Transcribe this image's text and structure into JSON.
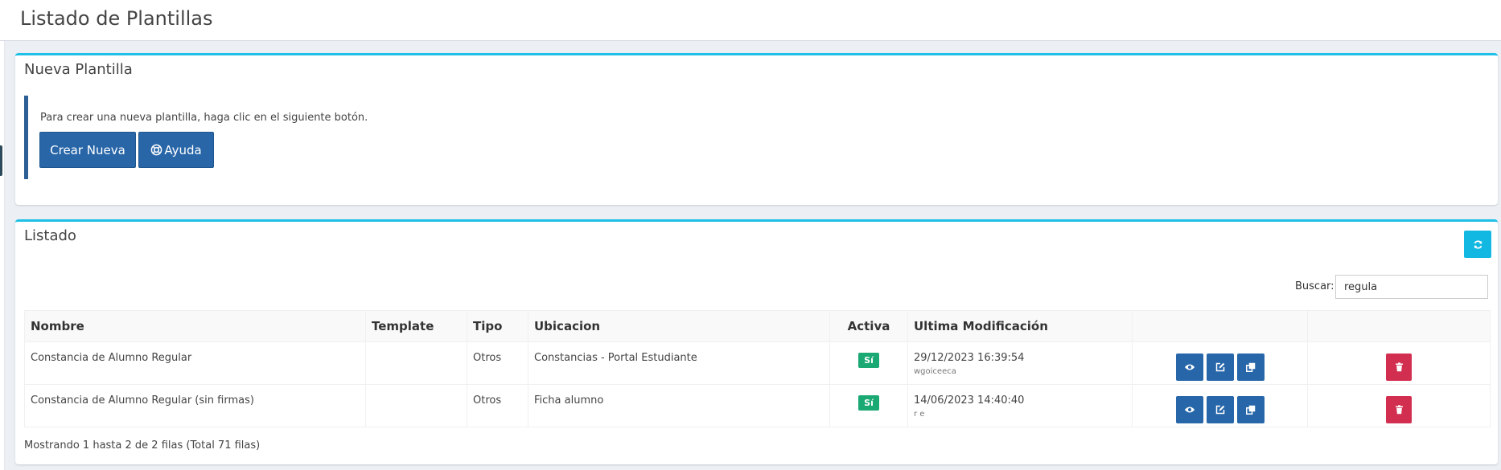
{
  "page": {
    "title": "Listado de Plantillas"
  },
  "new_template": {
    "title": "Nueva Plantilla",
    "description": "Para crear una nueva plantilla, haga clic en el siguiente botón.",
    "create_label": "Crear Nueva",
    "help_label": "Ayuda"
  },
  "listing": {
    "title": "Listado",
    "search_label": "Buscar:",
    "search_value": "regula",
    "columns": [
      "Nombre",
      "Template",
      "Tipo",
      "Ubicacion",
      "Activa",
      "Ultima Modificación"
    ],
    "rows": [
      {
        "nombre": "Constancia de Alumno Regular",
        "template": "",
        "tipo": "Otros",
        "ubicacion": "Constancias - Portal Estudiante",
        "activa": "Sí",
        "modificacion": "29/12/2023 16:39:54",
        "usuario": "wgoiceeca"
      },
      {
        "nombre": "Constancia de Alumno Regular (sin firmas)",
        "template": "",
        "tipo": "Otros",
        "ubicacion": "Ficha alumno",
        "activa": "Sí",
        "modificacion": "14/06/2023 14:40:40",
        "usuario": "r e"
      }
    ],
    "footer": "Mostrando 1 hasta 2 de 2 filas (Total 71 filas)"
  },
  "icons": {
    "refresh": "refresh-icon",
    "view": "eye-icon",
    "edit": "edit-icon",
    "duplicate": "copy-icon",
    "delete": "trash-icon",
    "help": "lifebuoy-icon"
  },
  "colors": {
    "accent_border": "#1fc0e8",
    "primary_button": "#2866a8",
    "active_badge": "#1aa873",
    "delete_button": "#d22e4f",
    "refresh_button": "#12b8e2"
  }
}
